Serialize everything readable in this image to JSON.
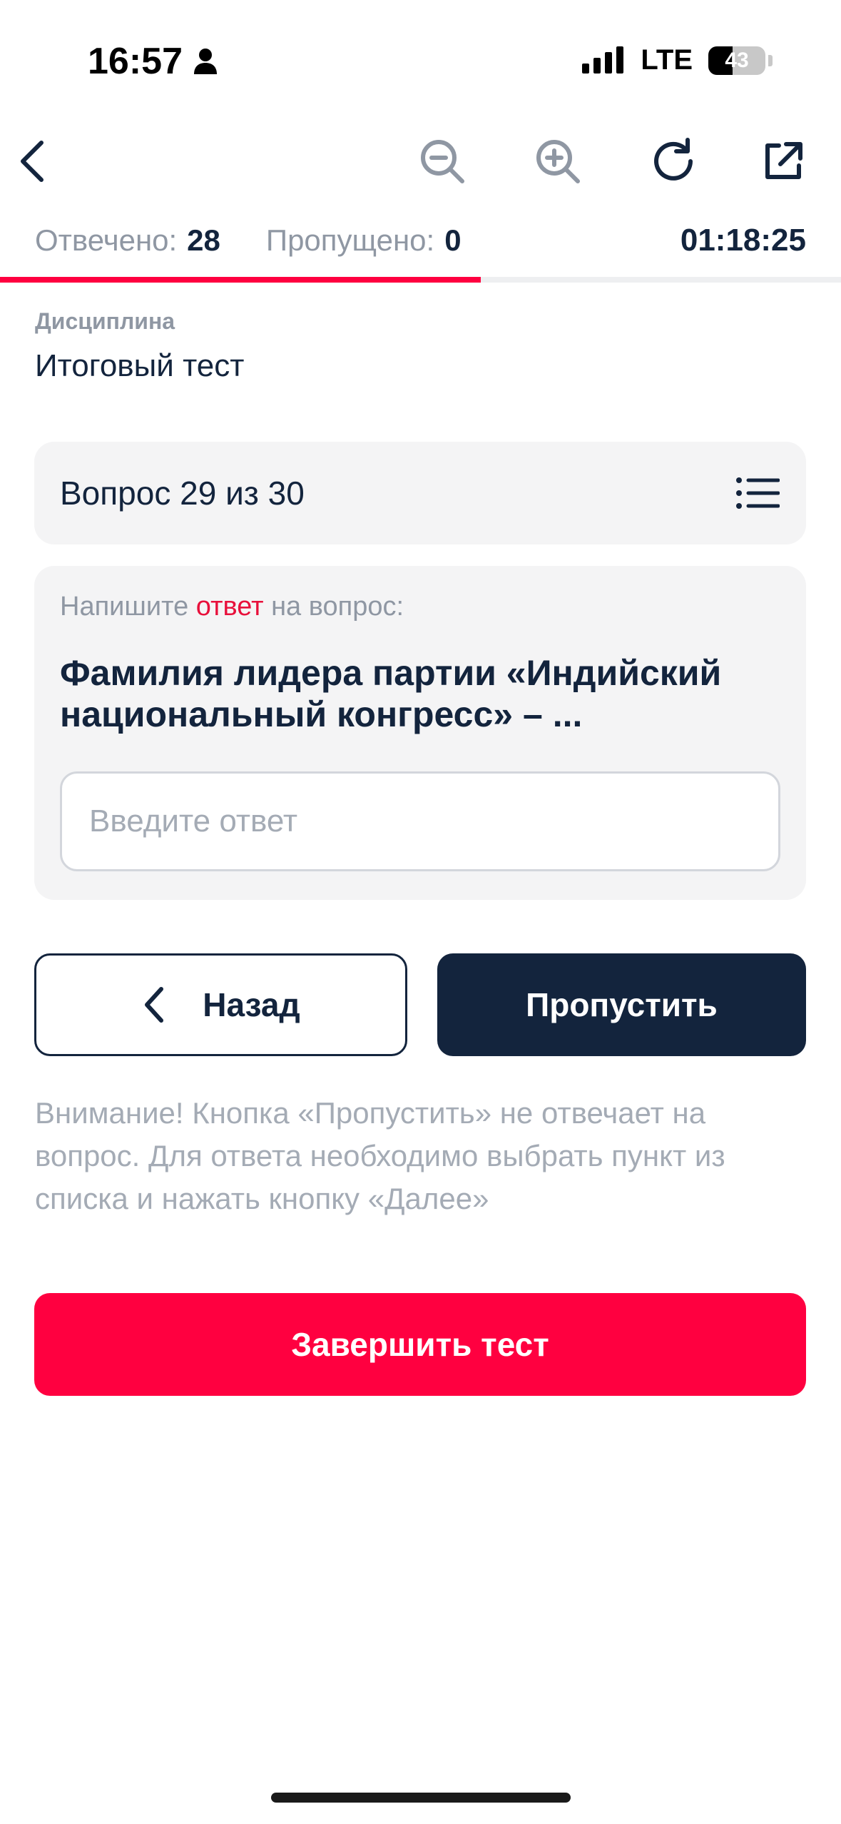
{
  "status_bar": {
    "time": "16:57",
    "network": "LTE",
    "battery": "43",
    "icons": [
      "person-icon",
      "signal-icon",
      "battery-icon"
    ]
  },
  "toolbar": {
    "icons": [
      "back-icon",
      "zoom-out-icon",
      "zoom-in-icon",
      "refresh-icon",
      "external-link-icon"
    ]
  },
  "stats": {
    "answered_label": "Отвечено:",
    "answered_value": "28",
    "skipped_label": "Пропущено:",
    "skipped_value": "0",
    "timer": "01:18:25",
    "progress": 0.572
  },
  "discipline": {
    "label": "Дисциплина",
    "value": "Итоговый тест"
  },
  "question": {
    "header": "Вопрос 29 из 30",
    "instruction_prefix": "Напишите ",
    "instruction_accent": "ответ",
    "instruction_suffix": " на вопрос:",
    "text": "Фамилия лидера партии «Индийский национальный конгресс» – ...",
    "answer_placeholder": "Введите ответ",
    "answer_value": ""
  },
  "buttons": {
    "back": "Назад",
    "skip": "Пропустить",
    "finish": "Завершить тест"
  },
  "note": "Внимание! Кнопка «Пропустить» не отвечает на вопрос. Для ответа необходимо выбрать пункт из списка и нажать кнопку «Далее»",
  "colors": {
    "accent": "#ff0040",
    "primary": "#13243d",
    "muted": "#8f97a3",
    "card": "#f4f4f5"
  }
}
